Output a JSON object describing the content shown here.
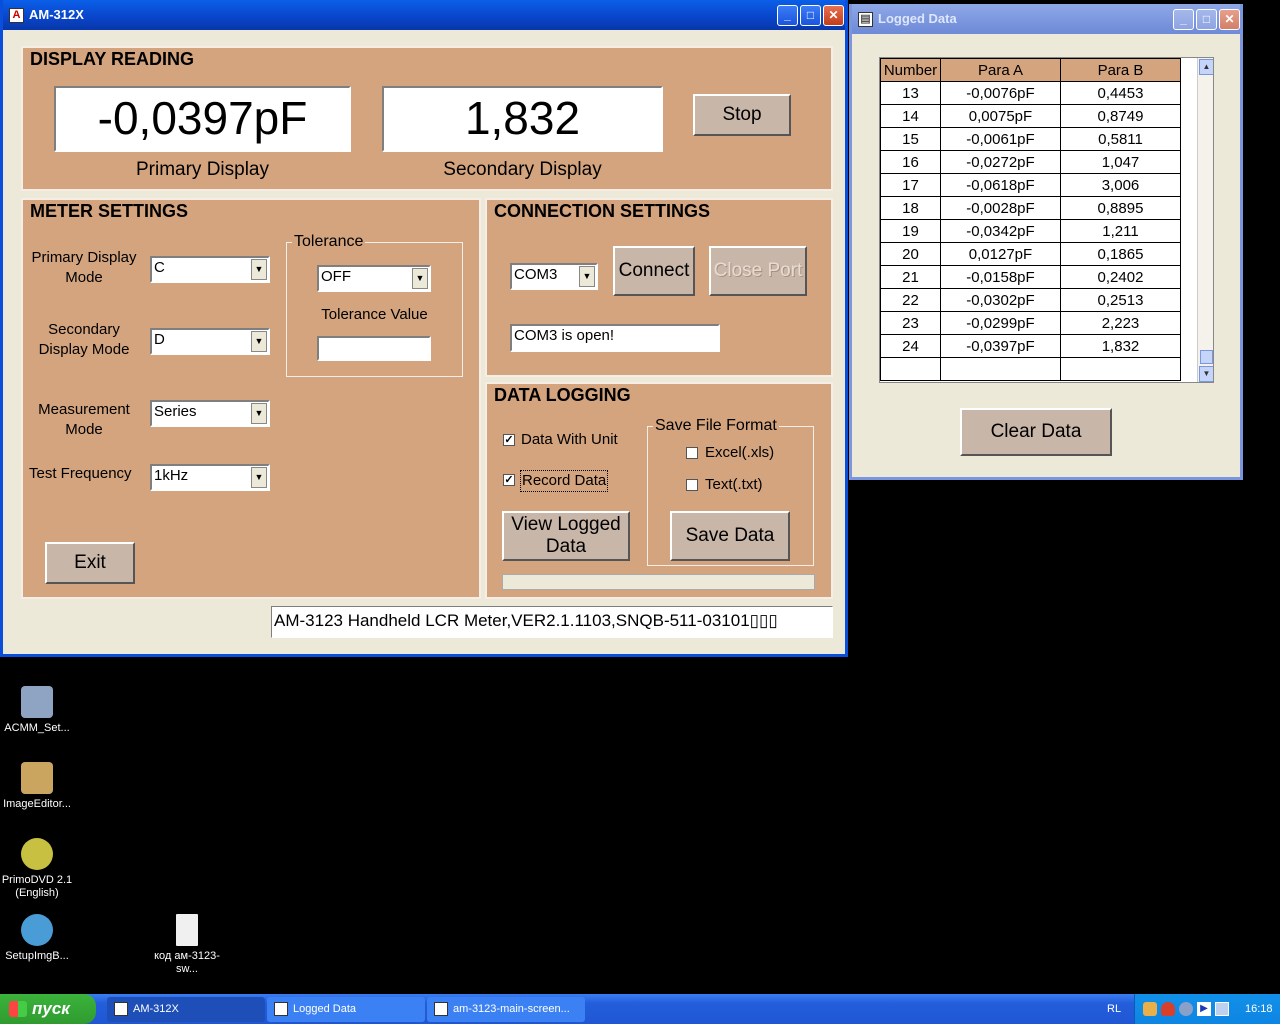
{
  "main_window": {
    "title": "AM-312X",
    "display_reading": {
      "title": "DISPLAY READING",
      "primary_value": "-0,0397pF",
      "secondary_value": "1,832",
      "primary_label": "Primary Display",
      "secondary_label": "Secondary Display",
      "stop_label": "Stop"
    },
    "meter_settings": {
      "title": "METER SETTINGS",
      "primary_mode_label": "Primary Display Mode",
      "primary_mode_value": "C",
      "secondary_mode_label": "Secondary Display Mode",
      "secondary_mode_value": "D",
      "measurement_mode_label": "Measurement Mode",
      "measurement_mode_value": "Series",
      "test_frequency_label": "Test Frequency",
      "test_frequency_value": "1kHz",
      "tolerance_title": "Tolerance",
      "tolerance_value": "OFF",
      "tolerance_value_label": "Tolerance Value",
      "tolerance_input": "",
      "exit_label": "Exit"
    },
    "connection_settings": {
      "title": "CONNECTION SETTINGS",
      "port_value": "COM3",
      "connect_label": "Connect",
      "close_port_label": "Close Port",
      "status_text": "COM3 is open!"
    },
    "data_logging": {
      "title": "DATA LOGGING",
      "data_with_unit_label": "Data With Unit",
      "data_with_unit_checked": true,
      "record_data_label": "Record Data",
      "record_data_checked": true,
      "view_logged_label": "View Logged Data",
      "save_format_title": "Save File Format",
      "excel_label": "Excel(.xls)",
      "text_label": "Text(.txt)",
      "save_data_label": "Save Data"
    },
    "status_bar": "AM-3123 Handheld LCR Meter,VER2.1.1103,SNQB-511-03101▯▯▯"
  },
  "logged_window": {
    "title": "Logged Data",
    "columns": [
      "Number",
      "Para A",
      "Para B"
    ],
    "rows": [
      [
        "13",
        "-0,0076pF",
        "0,4453"
      ],
      [
        "14",
        "0,0075pF",
        "0,8749"
      ],
      [
        "15",
        "-0,0061pF",
        "0,5811"
      ],
      [
        "16",
        "-0,0272pF",
        "1,047"
      ],
      [
        "17",
        "-0,0618pF",
        "3,006"
      ],
      [
        "18",
        "-0,0028pF",
        "0,8895"
      ],
      [
        "19",
        "-0,0342pF",
        "1,211"
      ],
      [
        "20",
        "0,0127pF",
        "0,1865"
      ],
      [
        "21",
        "-0,0158pF",
        "0,2402"
      ],
      [
        "22",
        "-0,0302pF",
        "0,2513"
      ],
      [
        "23",
        "-0,0299pF",
        "2,223"
      ],
      [
        "24",
        "-0,0397pF",
        "1,832"
      ],
      [
        "",
        "",
        ""
      ]
    ],
    "clear_label": "Clear Data"
  },
  "desktop_icons": [
    {
      "label": "ACMM_Set...",
      "color": "#8fa3c2"
    },
    {
      "label": "ImageEditor...",
      "color": "#c9a560"
    },
    {
      "label": "PrimoDVD 2.1 (English)",
      "color": "#c8c040"
    },
    {
      "label": "SetupImgB...",
      "color": "#4a9cd6"
    },
    {
      "label": "код ам-3123-sw...",
      "color": "#f0f0f0"
    }
  ],
  "taskbar": {
    "start_label": "пуск",
    "tasks": [
      "AM-312X",
      "Logged Data",
      "am-3123-main-screen..."
    ],
    "language": "RL",
    "clock": "16:18"
  }
}
